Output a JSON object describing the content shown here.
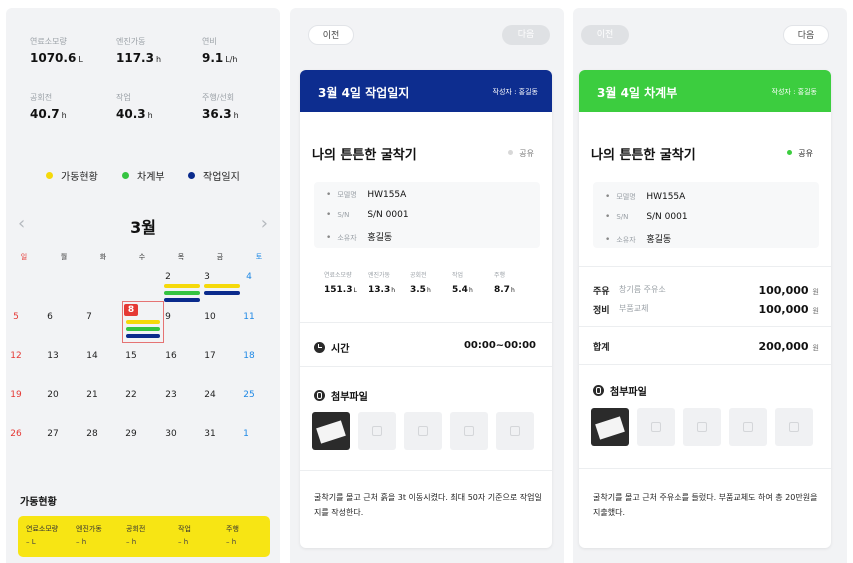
{
  "panel1": {
    "stats": [
      {
        "label": "연료소모량",
        "value": "1070.6",
        "unit": "L"
      },
      {
        "label": "엔진가동",
        "value": "117.3",
        "unit": "h"
      },
      {
        "label": "연비",
        "value": "9.1",
        "unit": "L/h"
      },
      {
        "label": "공회전",
        "value": "40.7",
        "unit": "h"
      },
      {
        "label": "작업",
        "value": "40.3",
        "unit": "h"
      },
      {
        "label": "주행/선회",
        "value": "36.3",
        "unit": "h"
      }
    ],
    "legend": [
      {
        "label": "가동현황",
        "color": "#f5d90a"
      },
      {
        "label": "차계부",
        "color": "#35c441"
      },
      {
        "label": "작업일지",
        "color": "#0a2a8c"
      }
    ],
    "calendar": {
      "month": "3월",
      "prev_icon": "‹",
      "next_icon": "›",
      "weekdays": [
        "일",
        "월",
        "화",
        "수",
        "목",
        "금",
        "토"
      ],
      "weeks": [
        [
          "",
          "",
          "",
          "",
          "2",
          "3",
          "4"
        ],
        [
          "5",
          "6",
          "7",
          "8",
          "9",
          "10",
          "11"
        ],
        [
          "12",
          "13",
          "14",
          "15",
          "16",
          "17",
          "18"
        ],
        [
          "19",
          "20",
          "21",
          "22",
          "23",
          "24",
          "25"
        ],
        [
          "26",
          "27",
          "28",
          "29",
          "30",
          "31",
          "1"
        ]
      ]
    },
    "status_title": "가동현황",
    "status_cols": [
      {
        "label": "연료소모량",
        "value": "– L"
      },
      {
        "label": "엔진가동",
        "value": "– h"
      },
      {
        "label": "공회전",
        "value": "– h"
      },
      {
        "label": "작업",
        "value": "– h"
      },
      {
        "label": "주행",
        "value": "– h"
      }
    ]
  },
  "panel2": {
    "prev_label": "이전",
    "next_label": "다음",
    "header_title": "3월 4일 작업일지",
    "author": "작성자 : 홍길동",
    "machine": "나의 튼튼한 굴착기",
    "share": "공유",
    "info": [
      {
        "key": "모델명",
        "value": "HW155A"
      },
      {
        "key": "S/N",
        "value": "S/N 0001"
      },
      {
        "key": "소유자",
        "value": "홍길동"
      }
    ],
    "mini_stats": [
      {
        "label": "연료소모량",
        "value": "151.3",
        "unit": "L"
      },
      {
        "label": "엔진가동",
        "value": "13.3",
        "unit": "h"
      },
      {
        "label": "공회전",
        "value": "3.5",
        "unit": "h"
      },
      {
        "label": "작업",
        "value": "5.4",
        "unit": "h"
      },
      {
        "label": "주행",
        "value": "8.7",
        "unit": "h"
      }
    ],
    "time_label": "시간",
    "time_value": "00:00~00:00",
    "attach_label": "첨부파일",
    "description": "굴착기를 몰고 근처 흙을 3t 이동시켰다. 최대 50자 기준으로 작업일지를 작성한다."
  },
  "panel3": {
    "prev_label": "이전",
    "next_label": "다음",
    "header_title": "3월 4일 차계부",
    "author": "작성자 : 홍길동",
    "machine": "나의 튼튼한 굴착기",
    "share": "공유",
    "info": [
      {
        "key": "모델명",
        "value": "HW155A"
      },
      {
        "key": "S/N",
        "value": "S/N 0001"
      },
      {
        "key": "소유자",
        "value": "홍길동"
      }
    ],
    "costs": [
      {
        "category": "주유",
        "detail": "창기름 주유소",
        "amount": "100,000",
        "unit": "원"
      },
      {
        "category": "정비",
        "detail": "부품교체",
        "amount": "100,000",
        "unit": "원"
      }
    ],
    "total_label": "합계",
    "total_amount": "200,000",
    "total_unit": "원",
    "attach_label": "첨부파일",
    "description": "굴착기를 몰고 근처 주유소를 들렀다. 부품교체도 하여 총 20만원을 지출했다."
  }
}
